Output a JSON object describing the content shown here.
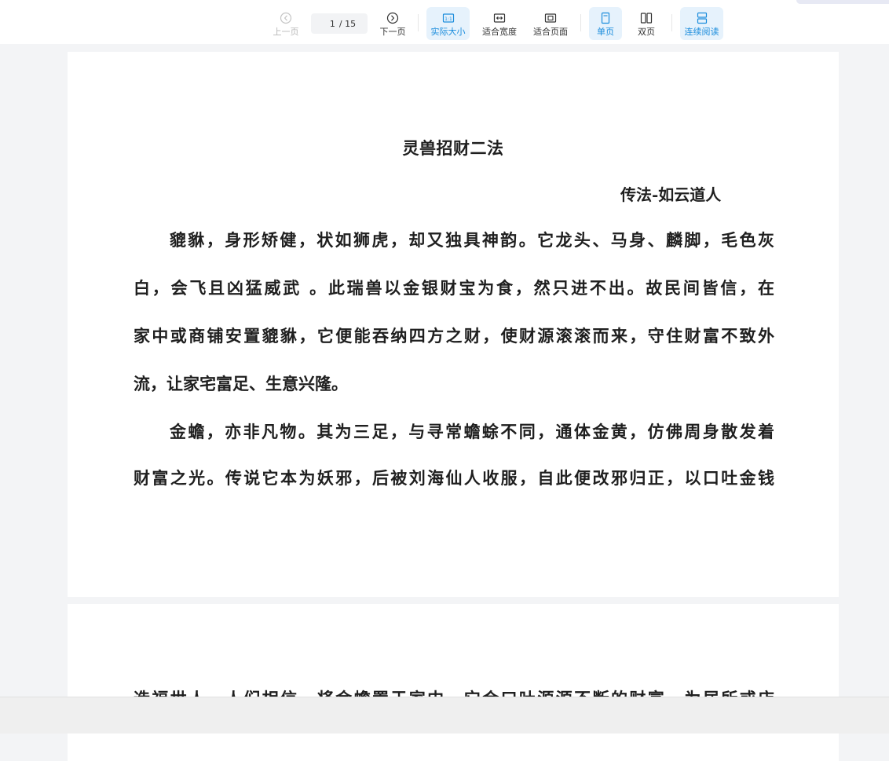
{
  "toolbar": {
    "prev_label": "上一页",
    "next_label": "下一页",
    "page_current": "1",
    "page_total": "/ 15",
    "actual_size_label": "实际大小",
    "fit_width_label": "适合宽度",
    "fit_page_label": "适合页面",
    "single_page_label": "单页",
    "double_page_label": "双页",
    "continuous_label": "连续阅读",
    "accent_color": "#1a8cdc",
    "active_bg_color": "#e6f2fc"
  },
  "document": {
    "title": "灵兽招财二法",
    "author": "传法-如云道人",
    "page1_lines": [
      "貔貅，身形矫健，状如狮虎，却又独具神韵。它龙头、马身、麟脚，毛色灰",
      "白，会飞且凶猛威武 。此瑞兽以金银财宝为食，然只进不出。故民间皆信，在",
      "家中或商铺安置貔貅，它便能吞纳四方之财，使财源滚滚而来，守住财富不致外",
      "流，让家宅富足、生意兴隆。",
      "金蟾，亦非凡物。其为三足，与寻常蟾蜍不同，通体金黄，仿佛周身散发着",
      "财富之光。传说它本为妖邪，后被刘海仙人收服，自此便改邪归正，以口吐金钱"
    ],
    "page2_lines": [
      "造福世人。人们相信，将金蟾置于家中，它会口吐源源不断的财富，为居所或店"
    ]
  }
}
